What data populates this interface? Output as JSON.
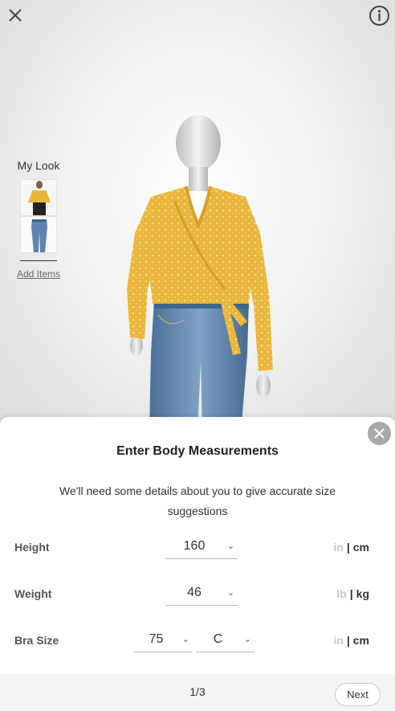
{
  "viewer": {
    "close_icon": "close-icon",
    "info_icon": "info-icon",
    "my_look": {
      "title": "My Look",
      "items": [
        {
          "name": "yellow-wrap-top-thumbnail"
        },
        {
          "name": "jeans-thumbnail"
        }
      ],
      "add_items_label": "Add Items"
    }
  },
  "sheet": {
    "title": "Enter Body Measurements",
    "description": "We'll need some details about you to give accurate size suggestions",
    "rows": [
      {
        "label": "Height",
        "values": [
          "160"
        ],
        "units": [
          "in",
          "cm"
        ],
        "active_unit": "cm"
      },
      {
        "label": "Weight",
        "values": [
          "46"
        ],
        "units": [
          "lb",
          "kg"
        ],
        "active_unit": "kg"
      },
      {
        "label": "Bra Size",
        "values": [
          "75",
          "C"
        ],
        "units": [
          "in",
          "cm"
        ],
        "active_unit": "cm"
      }
    ],
    "pager": "1/3",
    "next_label": "Next"
  },
  "colors": {
    "top": "#e9b73c",
    "jeans": "#5c84ad",
    "close_circle": "#a9a9a9"
  }
}
